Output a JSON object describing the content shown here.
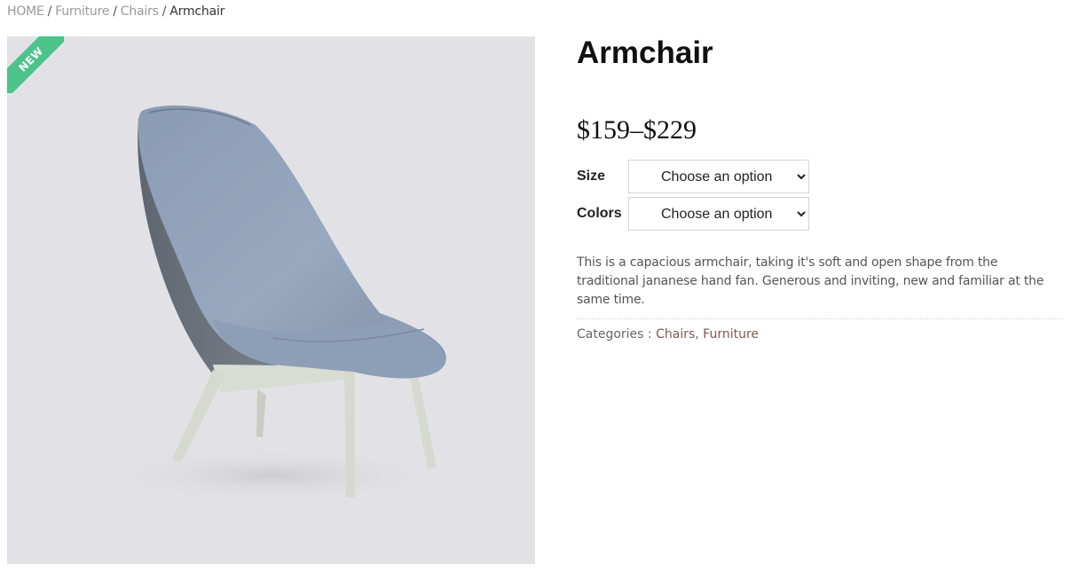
{
  "breadcrumb": {
    "items": [
      "HOME",
      "Furniture",
      "Chairs"
    ],
    "separator": "/",
    "current": "Armchair"
  },
  "product": {
    "badge": "NEW",
    "title": "Armchair",
    "price": "$159–$229",
    "description": "This is a capacious armchair, taking it's soft and open shape from the traditional jananese hand fan. Generous and inviting, new and familiar at the same time.",
    "categories_label": "Categories :",
    "categories": [
      "Chairs",
      "Furniture"
    ],
    "categories_joiner": ", "
  },
  "variations": {
    "size": {
      "label": "Size",
      "selected": "Choose an option"
    },
    "colors": {
      "label": "Colors",
      "selected": "Choose an option"
    }
  },
  "colors": {
    "badge": "#4cc38a",
    "image_bg": "#e2e2e6",
    "chair_fabric": "#8ea0b8",
    "chair_shell": "#707680",
    "chair_legs": "#d6d9cf"
  }
}
